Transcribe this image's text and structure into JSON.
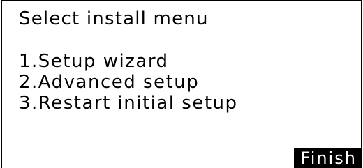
{
  "screen": {
    "title": "Select install menu",
    "menu_items": [
      {
        "label": "1.Setup wizard"
      },
      {
        "label": "2.Advanced setup"
      },
      {
        "label": "3.Restart initial setup"
      }
    ],
    "finish_label": "Finish"
  },
  "colors": {
    "background": "#ffffff",
    "foreground": "#000000",
    "button_background": "#000000",
    "button_text": "#ffffff"
  }
}
